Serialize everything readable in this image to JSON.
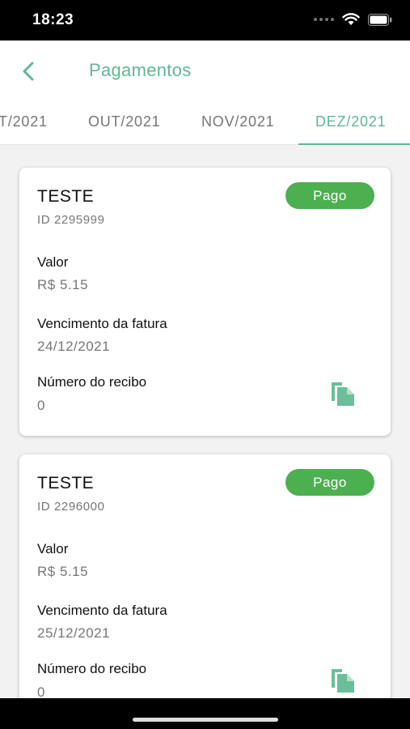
{
  "status_bar": {
    "time": "18:23"
  },
  "header": {
    "title": "Pagamentos"
  },
  "tabs": [
    {
      "label": "T/2021"
    },
    {
      "label": "OUT/2021"
    },
    {
      "label": "NOV/2021"
    },
    {
      "label": "DEZ/2021",
      "active": true
    }
  ],
  "payments": [
    {
      "title": "TESTE",
      "id": "ID 2295999",
      "status": "Pago",
      "valor_label": "Valor",
      "valor": "R$ 5.15",
      "vencimento_label": "Vencimento da fatura",
      "vencimento": "24/12/2021",
      "recibo_label": "Número do recibo",
      "recibo": "0"
    },
    {
      "title": "TESTE",
      "id": "ID 2296000",
      "status": "Pago",
      "valor_label": "Valor",
      "valor": "R$ 5.15",
      "vencimento_label": "Vencimento da fatura",
      "vencimento": "25/12/2021",
      "recibo_label": "Número do recibo",
      "recibo": "0"
    }
  ],
  "colors": {
    "accent": "#5fb894",
    "badge": "#4caf50",
    "icon": "#6abf9a"
  },
  "icons": {
    "back": "chevron-left-icon",
    "copy": "copy-icon"
  }
}
